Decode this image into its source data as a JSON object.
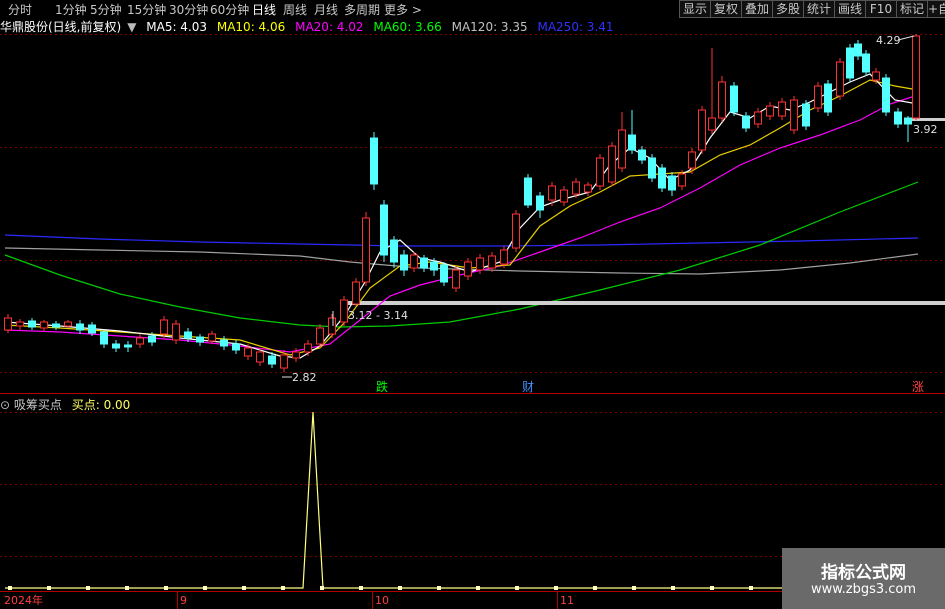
{
  "toolbar": {
    "periods": [
      "分时",
      "1分钟",
      "5分钟",
      "15分钟",
      "30分钟",
      "60分钟",
      "日线",
      "周线",
      "月线",
      "多周期",
      "更多 >"
    ],
    "active_period": "日线",
    "buttons": [
      "显示",
      "复权",
      "叠加",
      "多股",
      "统计",
      "画线",
      "F10",
      "标记",
      "+自"
    ]
  },
  "stock": {
    "title": "华鼎股份(日线,前复权)"
  },
  "ma_legend": [
    {
      "label": "MA5: 4.03",
      "color": "#ffffff"
    },
    {
      "label": "MA10: 4.06",
      "color": "#ffff00"
    },
    {
      "label": "MA20: 4.02",
      "color": "#ff00ff"
    },
    {
      "label": "MA60: 3.66",
      "color": "#00ff00"
    },
    {
      "label": "MA120: 3.35",
      "color": "#c0c0c0"
    },
    {
      "label": "MA250: 3.41",
      "color": "#3030ff"
    }
  ],
  "annotations": {
    "high": "4.29",
    "last": "3.92",
    "low": "2.82",
    "gap_range": "3.12 - 3.14",
    "marker_fall": "跌",
    "marker_finance": "财",
    "marker_rise": "涨"
  },
  "indicator": {
    "name": "吸筹买点",
    "value_label": "买点: 0.00"
  },
  "x_axis": {
    "labels": [
      "2024年",
      "9",
      "10",
      "11",
      "12"
    ]
  },
  "watermark": {
    "title": "指标公式网",
    "url": "www.zbgs3.com"
  },
  "colors": {
    "up": "#ff3232",
    "down": "#54ffff",
    "grid": "#8b0000",
    "indicator_line": "#ffff80"
  }
}
